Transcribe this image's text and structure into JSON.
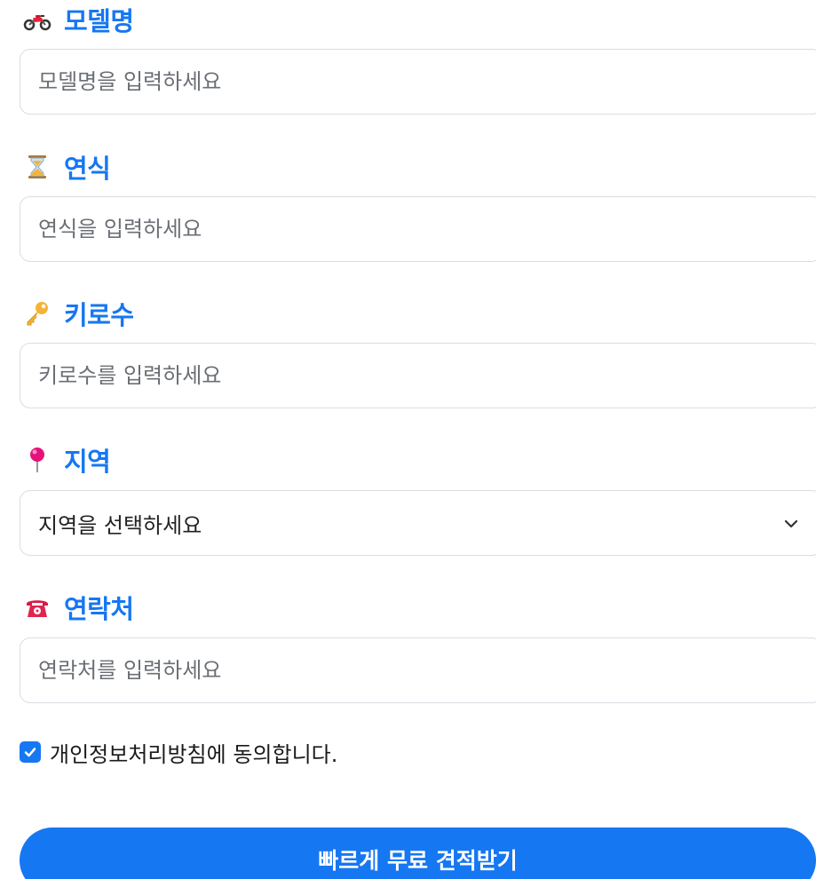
{
  "form": {
    "model": {
      "label": "모델명",
      "icon": "motorcycle-icon",
      "placeholder": "모델명을 입력하세요",
      "value": ""
    },
    "year": {
      "label": "연식",
      "icon": "hourglass-icon",
      "placeholder": "연식을 입력하세요",
      "value": ""
    },
    "mileage": {
      "label": "키로수",
      "icon": "key-icon",
      "placeholder": "키로수를 입력하세요",
      "value": ""
    },
    "region": {
      "label": "지역",
      "icon": "pushpin-icon",
      "selected": "지역을 선택하세요"
    },
    "contact": {
      "label": "연락처",
      "icon": "telephone-icon",
      "placeholder": "연락처를 입력하세요",
      "value": ""
    },
    "consent": {
      "label": "개인정보처리방침에 동의합니다.",
      "checked": true
    },
    "submit": {
      "label": "빠르게 무료 견적받기"
    }
  },
  "colors": {
    "accent": "#1677f2",
    "border": "#d9dde3",
    "placeholder": "#6b6f75"
  }
}
